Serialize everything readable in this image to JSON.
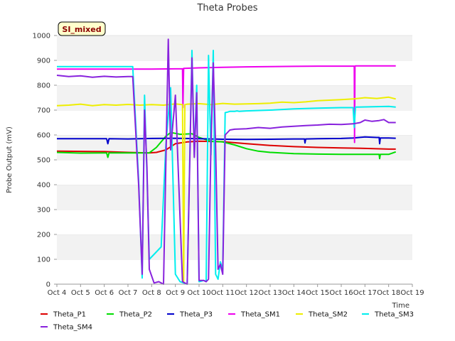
{
  "chart_data": {
    "type": "line",
    "title": "Theta Probes",
    "site_tag": "SI_mixed",
    "xlabel": "Time",
    "ylabel": "Probe Output (mV)",
    "xlim": [
      4,
      19
    ],
    "ylim": [
      0,
      1000
    ],
    "x_ticks": [
      4,
      5,
      6,
      7,
      8,
      9,
      10,
      11,
      12,
      13,
      14,
      15,
      16,
      17,
      18,
      19
    ],
    "x_tick_labels": [
      "Oct 4",
      "Oct 5",
      "Oct 6",
      "Oct 7",
      "Oct 8",
      "Oct 9",
      "Oct 10",
      "Oct 11",
      "Oct 12",
      "Oct 13",
      "Oct 14",
      "Oct 15",
      "Oct 16",
      "Oct 17",
      "Oct 18",
      "Oct 19"
    ],
    "y_ticks": [
      0,
      100,
      200,
      300,
      400,
      500,
      600,
      700,
      800,
      900,
      1000
    ],
    "grid": "horizontal bands",
    "legend_position": "bottom",
    "series": [
      {
        "name": "Theta_P1",
        "color": "#dd0000",
        "x": [
          4.0,
          6.0,
          7.0,
          7.9,
          8.2,
          8.6,
          9.0,
          9.5,
          10.0,
          11.0,
          12.0,
          13.0,
          14.0,
          15.0,
          16.0,
          17.0,
          18.0,
          18.3
        ],
        "y": [
          535,
          533,
          530,
          528,
          530,
          540,
          565,
          572,
          575,
          573,
          565,
          558,
          553,
          550,
          548,
          546,
          543,
          543
        ]
      },
      {
        "name": "Theta_P2",
        "color": "#00dd00",
        "x": [
          4.0,
          5.0,
          6.0,
          6.1,
          6.15,
          6.2,
          7.0,
          7.9,
          8.2,
          8.6,
          8.8,
          9.2,
          9.7,
          10.0,
          10.5,
          11.0,
          11.5,
          12.0,
          12.5,
          13.0,
          14.0,
          15.0,
          16.0,
          17.0,
          17.6,
          17.62,
          17.65,
          18.0,
          18.3
        ],
        "y": [
          530,
          527,
          528,
          528,
          510,
          528,
          528,
          528,
          550,
          595,
          610,
          603,
          605,
          590,
          575,
          572,
          560,
          545,
          535,
          530,
          525,
          523,
          522,
          522,
          522,
          505,
          522,
          522,
          532
        ]
      },
      {
        "name": "Theta_P3",
        "color": "#0000cc",
        "x": [
          4.0,
          5.0,
          6.0,
          6.1,
          6.15,
          6.2,
          7.0,
          8.0,
          9.0,
          10.0,
          11.0,
          12.0,
          13.0,
          14.0,
          14.45,
          14.47,
          14.5,
          15.0,
          16.0,
          16.5,
          17.0,
          17.5,
          17.6,
          17.62,
          17.65,
          18.0,
          18.3
        ],
        "y": [
          585,
          585,
          585,
          585,
          565,
          585,
          584,
          586,
          587,
          585,
          583,
          582,
          583,
          584,
          584,
          568,
          584,
          585,
          586,
          588,
          592,
          590,
          590,
          565,
          588,
          588,
          587
        ]
      },
      {
        "name": "Theta_SM1",
        "color": "#ee00ee",
        "x": [
          4.0,
          6.0,
          8.0,
          9.0,
          9.3,
          9.32,
          9.35,
          10.0,
          11.0,
          12.0,
          13.0,
          14.0,
          15.0,
          16.0,
          16.55,
          16.56,
          16.58,
          16.6,
          17.0,
          18.0,
          18.3
        ],
        "y": [
          865,
          865,
          865,
          866,
          866,
          710,
          868,
          870,
          872,
          874,
          875,
          876,
          877,
          877,
          877,
          570,
          877,
          878,
          878,
          878,
          878
        ]
      },
      {
        "name": "Theta_SM2",
        "color": "#eeee00",
        "x": [
          4.0,
          4.5,
          5.0,
          5.5,
          6.0,
          6.5,
          7.0,
          7.5,
          8.0,
          8.5,
          9.0,
          9.3,
          9.35,
          9.4,
          9.5,
          10.0,
          10.5,
          11.0,
          11.5,
          12.0,
          12.5,
          13.0,
          13.5,
          14.0,
          14.5,
          15.0,
          15.5,
          16.0,
          16.5,
          17.0,
          17.5,
          18.0,
          18.3
        ],
        "y": [
          718,
          720,
          724,
          718,
          722,
          720,
          723,
          720,
          722,
          720,
          725,
          722,
          10,
          722,
          724,
          726,
          722,
          727,
          724,
          725,
          726,
          728,
          732,
          730,
          733,
          738,
          740,
          742,
          745,
          750,
          747,
          752,
          745
        ]
      },
      {
        "name": "Theta_SM3",
        "color": "#00eeee",
        "x": [
          4.0,
          7.2,
          7.45,
          7.6,
          7.7,
          7.8,
          7.9,
          8.1,
          8.4,
          8.6,
          8.8,
          9.0,
          9.2,
          9.5,
          9.7,
          9.8,
          9.9,
          10.0,
          10.2,
          10.3,
          10.4,
          10.5,
          10.6,
          10.7,
          10.8,
          10.9,
          11.0,
          11.1,
          11.2,
          11.3,
          11.5,
          11.6,
          11.7,
          12.0,
          13.0,
          14.0,
          15.0,
          16.0,
          16.5,
          16.55,
          16.6,
          17.0,
          18.0,
          18.3
        ],
        "y": [
          875,
          875,
          420,
          25,
          760,
          440,
          100,
          120,
          150,
          560,
          790,
          40,
          10,
          0,
          940,
          520,
          800,
          10,
          15,
          10,
          920,
          520,
          940,
          40,
          20,
          90,
          60,
          690,
          692,
          695,
          695,
          697,
          695,
          697,
          700,
          705,
          708,
          710,
          710,
          630,
          712,
          713,
          715,
          712
        ]
      },
      {
        "name": "Theta_SM4",
        "color": "#8822dd",
        "x": [
          4.0,
          4.5,
          5.0,
          5.5,
          6.0,
          6.5,
          7.0,
          7.2,
          7.45,
          7.6,
          7.7,
          7.8,
          7.9,
          8.1,
          8.3,
          8.5,
          8.7,
          8.8,
          9.0,
          9.3,
          9.5,
          9.7,
          9.8,
          9.9,
          10.0,
          10.2,
          10.3,
          10.4,
          10.5,
          10.6,
          10.7,
          10.8,
          10.9,
          11.0,
          11.1,
          11.3,
          11.5,
          12.0,
          12.5,
          13.0,
          13.5,
          14.0,
          14.5,
          15.0,
          15.5,
          16.0,
          16.5,
          16.8,
          17.0,
          17.3,
          17.6,
          17.8,
          18.0,
          18.3
        ],
        "y": [
          840,
          835,
          838,
          832,
          836,
          833,
          835,
          835,
          400,
          40,
          700,
          470,
          60,
          5,
          10,
          0,
          985,
          540,
          760,
          10,
          0,
          910,
          510,
          770,
          15,
          15,
          10,
          20,
          560,
          890,
          550,
          60,
          80,
          40,
          600,
          620,
          623,
          625,
          630,
          627,
          632,
          635,
          638,
          640,
          643,
          642,
          645,
          650,
          660,
          655,
          658,
          662,
          650,
          650
        ]
      }
    ]
  }
}
